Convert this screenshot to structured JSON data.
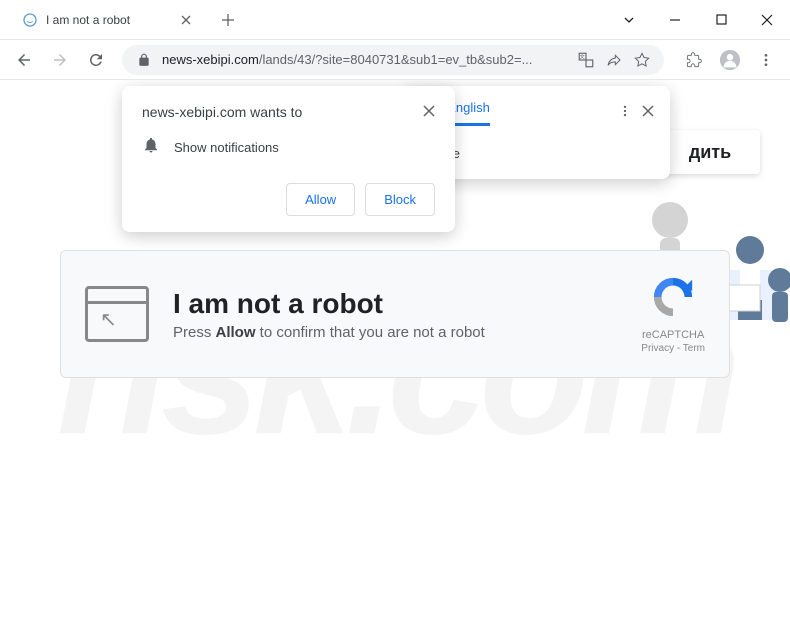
{
  "tab": {
    "title": "I am not a robot"
  },
  "address": {
    "domain": "news-xebipi.com",
    "path": "/lands/43/?site=8040731&sub1=ev_tb&sub2=..."
  },
  "notification": {
    "title": "news-xebipi.com wants to",
    "body": "Show notifications",
    "allow": "Allow",
    "block": "Block"
  },
  "translate": {
    "tab1": "n",
    "tab2": "English",
    "body": "anslate"
  },
  "page": {
    "button_text": "дить",
    "robot_title": "I am not a robot",
    "robot_sub_pre": "Press ",
    "robot_sub_bold": "Allow",
    "robot_sub_post": " to confirm that you are not a robot",
    "recaptcha_label": "reCAPTCHA",
    "recaptcha_links": "Privacy - Term"
  },
  "watermark": {
    "text": "risk.com"
  }
}
